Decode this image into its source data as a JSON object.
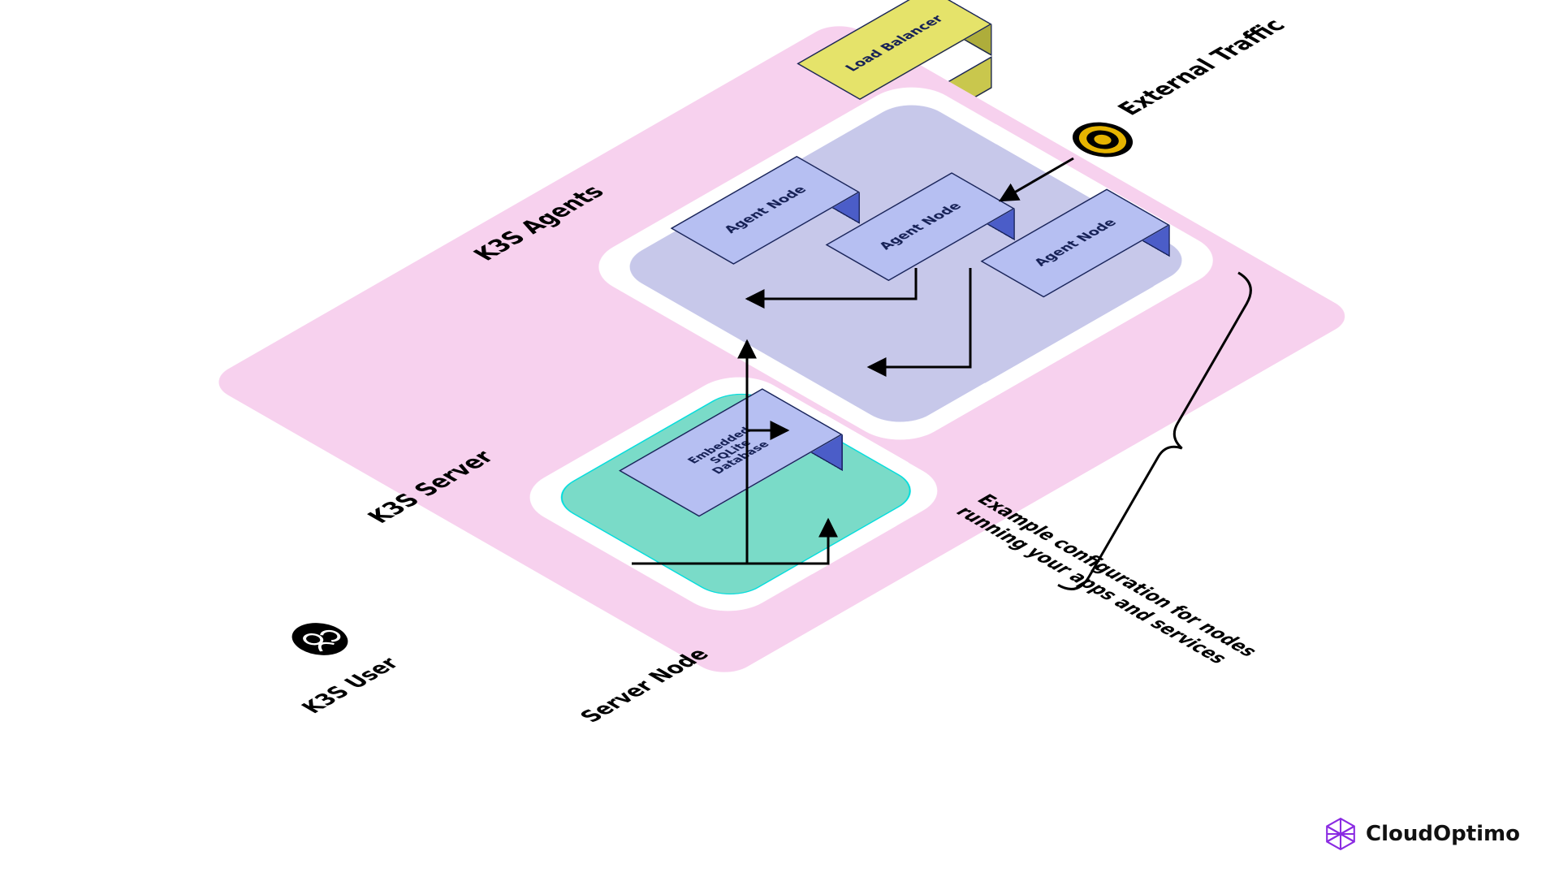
{
  "labels": {
    "external_traffic": "External Traffic",
    "k3s_agents": "K3S Agents",
    "k3s_server": "K3S Server",
    "k3s_user": "K3S User",
    "server_node": "Server Node",
    "config_note_line1": "Example configuration for nodes",
    "config_note_line2": "running your apps and services"
  },
  "boxes": {
    "load_balancer": "Load Balancer",
    "agent_node": "Agent Node",
    "embedded_db_l1": "Embedded",
    "embedded_db_l2": "SQLite",
    "embedded_db_l3": "Database"
  },
  "brand": "CloudOptimo",
  "colors": {
    "pink": "#f7d1ee",
    "agents_bg": "#c7c8ea",
    "server_bg": "#7adbc8",
    "box_top_blue": "#b6bff2",
    "box_front_blue": "#6b7ee0",
    "box_side_blue": "#4b5dc8",
    "lb_top": "#e5e36a",
    "lb_front": "#c9c74d",
    "lb_side": "#aead3b",
    "brand_purple": "#8a2be2"
  }
}
